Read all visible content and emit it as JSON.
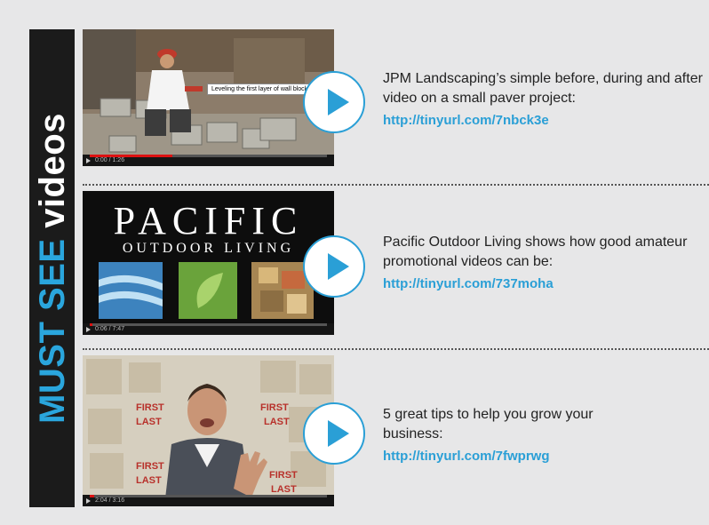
{
  "sidebar": {
    "word_must": "MUST",
    "word_see": "SEE",
    "word_videos": "videos"
  },
  "videos": [
    {
      "description": "JPM Landscaping’s simple before, during and after video on a small paver project:",
      "link": "http://tinyurl.com/7nbck3e",
      "thumbnail_caption": "Leveling the first layer of wall blocks",
      "time": "0:00 / 1:26",
      "progress": 0.35
    },
    {
      "description": "Pacific Outdoor Living shows how good amateur promotional videos can be:",
      "link": "http://tinyurl.com/737moha",
      "thumbnail_title": "PACIFIC",
      "thumbnail_subtitle": "OUTDOOR LIVING",
      "time": "0:06 / 7:47",
      "progress": 0.01
    },
    {
      "description": "5 great tips to help you grow your business:",
      "link": "http://tinyurl.com/7fwprwg",
      "time": "2:04 / 3:16",
      "progress": 0.02
    }
  ],
  "colors": {
    "accent": "#2a9fd6",
    "banner": "#1b1b1b",
    "background": "#e7e7e8"
  }
}
